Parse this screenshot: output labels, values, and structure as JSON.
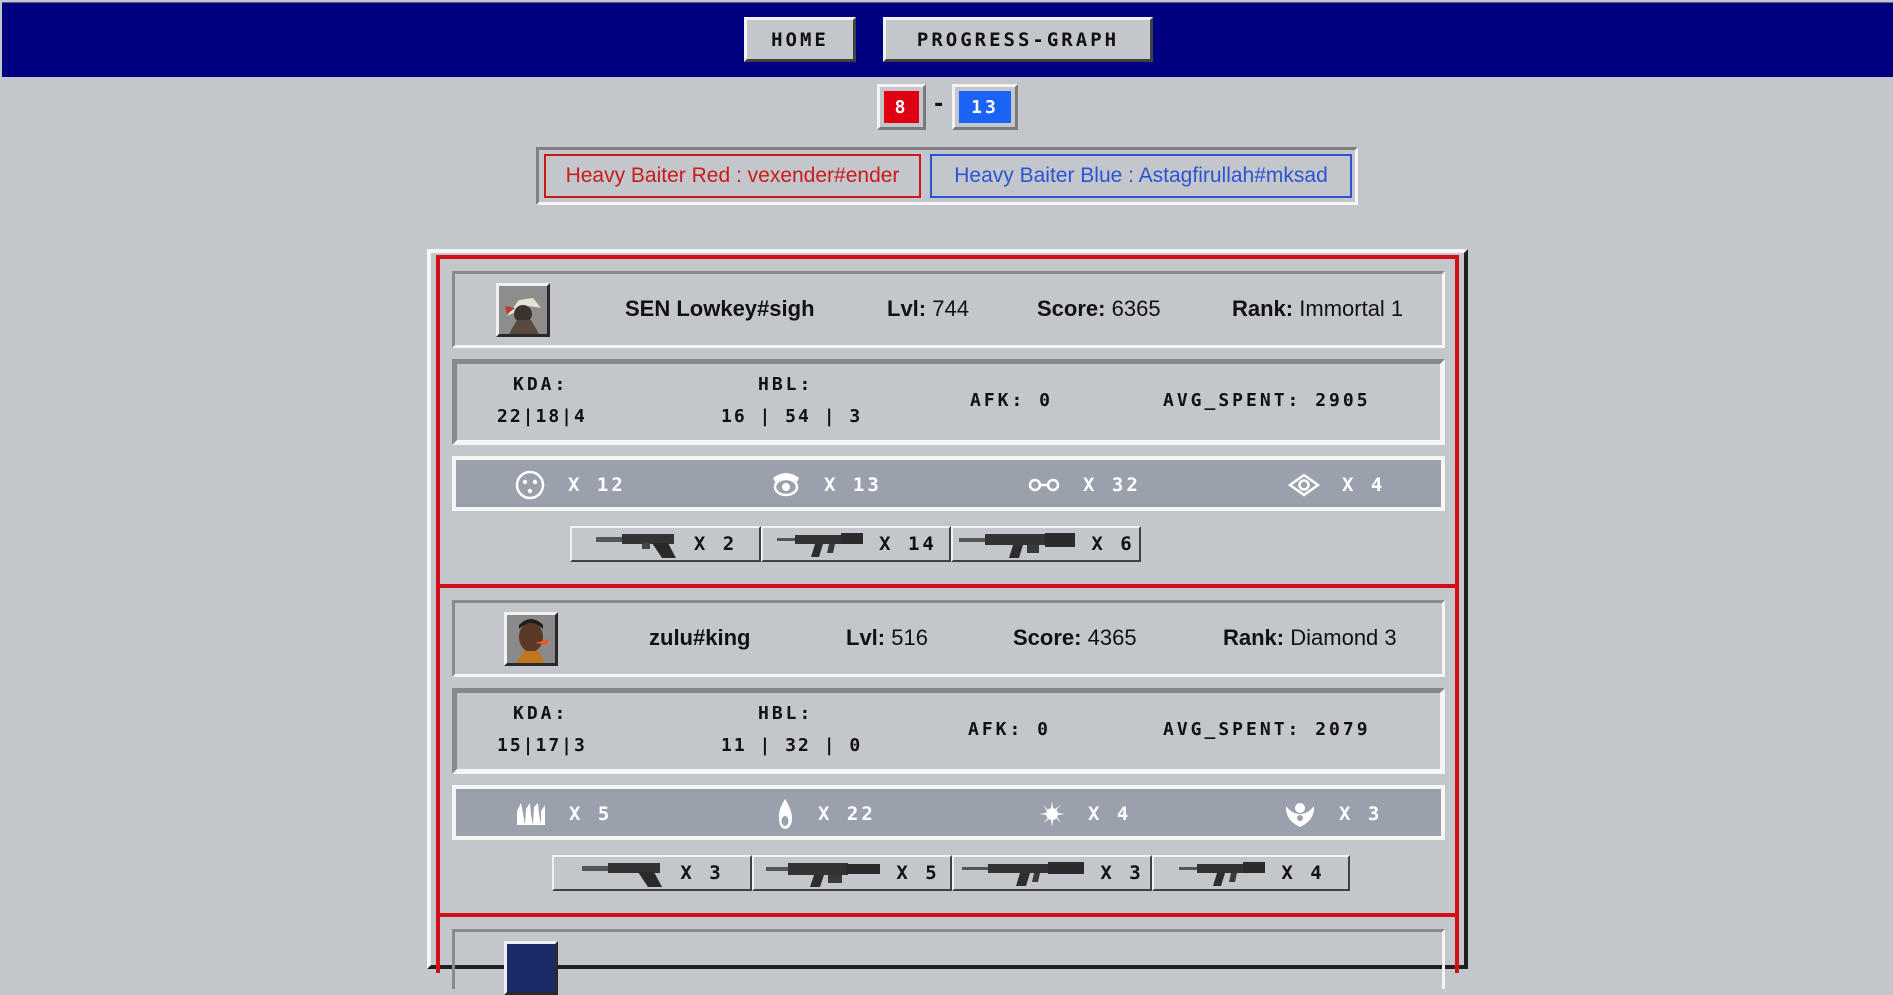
{
  "nav": {
    "home_label": "HOME",
    "graph_label": "PROGRESS-GRAPH"
  },
  "score": {
    "red": "8",
    "separator": "-",
    "blue": "13",
    "red_color": "#e00012",
    "blue_color": "#1a63f5"
  },
  "baiters": {
    "red": "Heavy Baiter Red : vexender#ender",
    "blue": "Heavy Baiter Blue : Astagfirullah#mksad"
  },
  "players": [
    {
      "name": "SEN Lowkey#sigh",
      "lvl_label": "Lvl:",
      "lvl": "744",
      "score_label": "Score:",
      "score": "6365",
      "rank_label": "Rank:",
      "rank": "Immortal 1",
      "kda_label": "KDA:",
      "kda": "22|18|4",
      "hbl_label": "HBL:",
      "hbl": "16 | 54 | 3",
      "afk": "AFK: 0",
      "avg_spent": "AVG_SPENT: 2905",
      "abilities": [
        {
          "icon": "ability-face-icon",
          "count": "X 12"
        },
        {
          "icon": "ability-eye-icon",
          "count": "X 13"
        },
        {
          "icon": "ability-link-icon",
          "count": "X 32"
        },
        {
          "icon": "ability-vision-icon",
          "count": "X 4"
        }
      ],
      "guns": [
        {
          "icon": "pistol-icon",
          "count": "X 2"
        },
        {
          "icon": "rifle-icon",
          "count": "X 14"
        },
        {
          "icon": "heavy-rifle-icon",
          "count": "X 6"
        }
      ]
    },
    {
      "name": "zulu#king",
      "lvl_label": "Lvl:",
      "lvl": "516",
      "score_label": "Score:",
      "score": "4365",
      "rank_label": "Rank:",
      "rank": "Diamond 3",
      "kda_label": "KDA:",
      "kda": "15|17|3",
      "hbl_label": "HBL:",
      "hbl": "11 | 32 | 0",
      "afk": "AFK: 0",
      "avg_spent": "AVG_SPENT: 2079",
      "abilities": [
        {
          "icon": "ability-wall-icon",
          "count": "X 5"
        },
        {
          "icon": "ability-flame-icon",
          "count": "X 22"
        },
        {
          "icon": "ability-flash-icon",
          "count": "X 4"
        },
        {
          "icon": "ability-heal-icon",
          "count": "X 3"
        }
      ],
      "guns": [
        {
          "icon": "pistol-icon",
          "count": "X 3"
        },
        {
          "icon": "smg-icon",
          "count": "X 5"
        },
        {
          "icon": "rifle-icon",
          "count": "X 3"
        },
        {
          "icon": "rifle-icon",
          "count": "X 4"
        }
      ]
    }
  ]
}
